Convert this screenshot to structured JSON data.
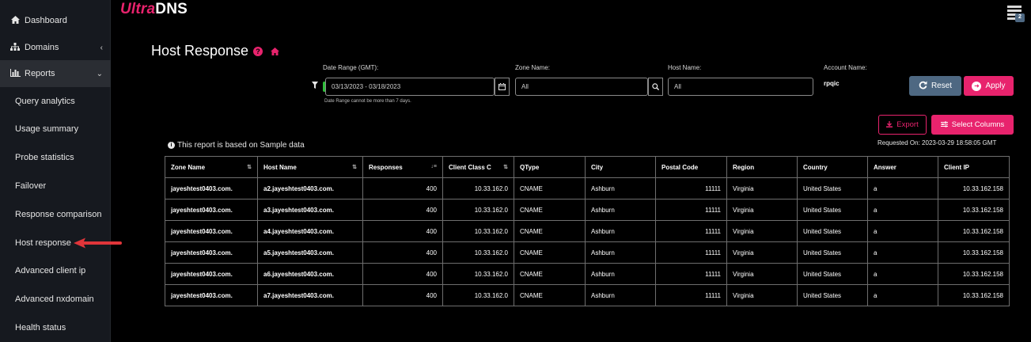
{
  "brand": {
    "ultra": "Ultra",
    "dns": "DNS"
  },
  "notifications": {
    "count": "2"
  },
  "sidebar": {
    "items": [
      {
        "label": "Dashboard",
        "icon": "home-icon"
      },
      {
        "label": "Domains",
        "icon": "sitemap-icon",
        "chevron": "‹"
      },
      {
        "label": "Reports",
        "icon": "bar-chart-icon",
        "chevron": "⌄"
      }
    ],
    "subitems": [
      "Query analytics",
      "Usage summary",
      "Probe statistics",
      "Failover",
      "Response comparison",
      "Host response",
      "Advanced client ip",
      "Advanced nxdomain",
      "Health status"
    ]
  },
  "page": {
    "title": "Host Response"
  },
  "filters": {
    "date_label": "Date Range (GMT):",
    "date_value": "03/13/2023 - 03/18/2023",
    "date_hint": "Date Range cannot be more than 7 days.",
    "zone_label": "Zone Name:",
    "zone_value": "All",
    "host_label": "Host Name:",
    "host_value": "All",
    "account_label": "Account Name:",
    "account_value": "rpqic"
  },
  "buttons": {
    "reset": "Reset",
    "apply": "Apply",
    "export": "Export",
    "select_columns": "Select Columns"
  },
  "report": {
    "note": "This report is based on Sample data",
    "requested_label": "Requested On:",
    "requested_value": "2023-03-29 18:58:05 GMT"
  },
  "table": {
    "columns": [
      "Zone Name",
      "Host Name",
      "Responses",
      "Client Class C",
      "QType",
      "City",
      "Postal Code",
      "Region",
      "Country",
      "Answer",
      "Client IP"
    ],
    "rows": [
      [
        "jayeshtest0403.com.",
        "a2.jayeshtest0403.com.",
        "400",
        "10.33.162.0",
        "CNAME",
        "Ashburn",
        "11111",
        "Virginia",
        "United States",
        "a",
        "10.33.162.158"
      ],
      [
        "jayeshtest0403.com.",
        "a3.jayeshtest0403.com.",
        "400",
        "10.33.162.0",
        "CNAME",
        "Ashburn",
        "11111",
        "Virginia",
        "United States",
        "a",
        "10.33.162.158"
      ],
      [
        "jayeshtest0403.com.",
        "a4.jayeshtest0403.com.",
        "400",
        "10.33.162.0",
        "CNAME",
        "Ashburn",
        "11111",
        "Virginia",
        "United States",
        "a",
        "10.33.162.158"
      ],
      [
        "jayeshtest0403.com.",
        "a5.jayeshtest0403.com.",
        "400",
        "10.33.162.0",
        "CNAME",
        "Ashburn",
        "11111",
        "Virginia",
        "United States",
        "a",
        "10.33.162.158"
      ],
      [
        "jayeshtest0403.com.",
        "a6.jayeshtest0403.com.",
        "400",
        "10.33.162.0",
        "CNAME",
        "Ashburn",
        "11111",
        "Virginia",
        "United States",
        "a",
        "10.33.162.158"
      ],
      [
        "jayeshtest0403.com.",
        "a7.jayeshtest0403.com.",
        "400",
        "10.33.162.0",
        "CNAME",
        "Ashburn",
        "11111",
        "Virginia",
        "United States",
        "a",
        "10.33.162.158"
      ]
    ]
  },
  "colors": {
    "accent": "#e8236d",
    "reset": "#4e6882",
    "annotation_arrow": "#e0353a"
  }
}
